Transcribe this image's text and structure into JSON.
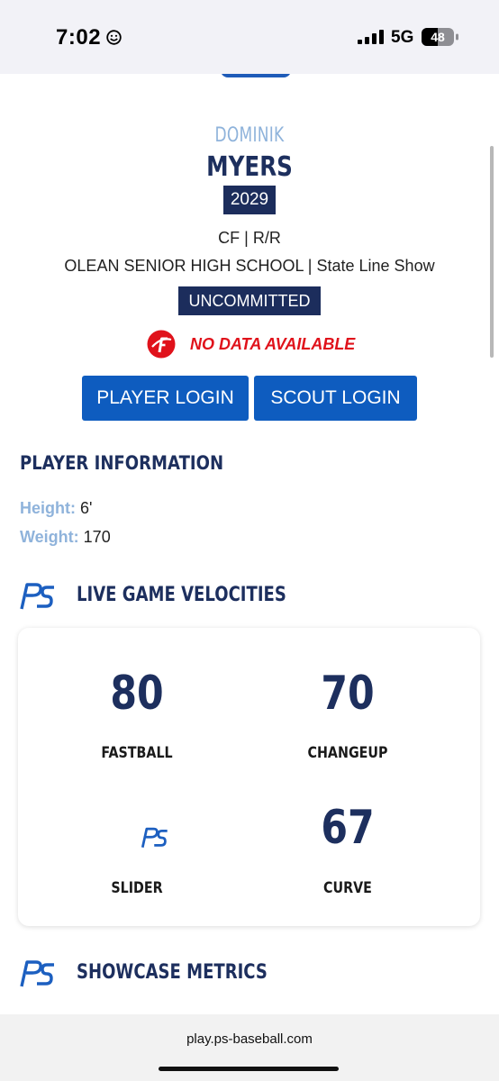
{
  "status_bar": {
    "time": "7:02",
    "network": "5G",
    "battery": "48"
  },
  "player": {
    "first_name": "DOMINIK",
    "last_name": "MYERS",
    "class_year": "2029",
    "position_line": "CF | R/R",
    "school_line": "OLEAN SENIOR HIGH SCHOOL | State Line Show",
    "commitment": "UNCOMMITTED",
    "data_status": "NO DATA AVAILABLE"
  },
  "buttons": {
    "player_login": "PLAYER LOGIN",
    "scout_login": "SCOUT LOGIN"
  },
  "player_information": {
    "heading": "PLAYER INFORMATION",
    "height_label": "Height:",
    "height_value": "6'",
    "weight_label": "Weight:",
    "weight_value": "170"
  },
  "live_game_velocities": {
    "heading": "LIVE GAME VELOCITIES",
    "pitches": [
      {
        "value": "80",
        "label": "FASTBALL"
      },
      {
        "value": "70",
        "label": "CHANGEUP"
      },
      {
        "value": "",
        "label": "SLIDER"
      },
      {
        "value": "67",
        "label": "CURVE"
      }
    ]
  },
  "showcase_metrics": {
    "heading": "SHOWCASE METRICS"
  },
  "browser": {
    "url": "play.ps-baseball.com"
  },
  "colors": {
    "navy": "#1c2d5c",
    "accent_blue": "#0e5cbf",
    "light_blue": "#8fb3db",
    "alert_red": "#e0121b"
  },
  "icons": [
    "smiley-icon",
    "signal-icon",
    "battery-icon",
    "perfect-game-icon",
    "ps-logo-icon"
  ]
}
